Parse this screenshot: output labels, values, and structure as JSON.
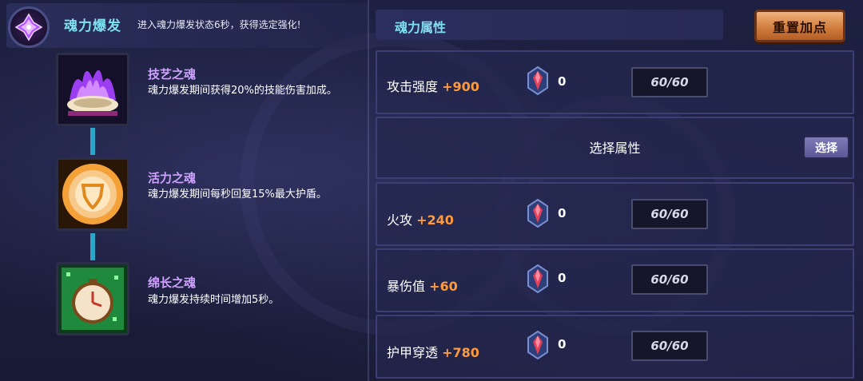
{
  "burst": {
    "title": "魂力爆发",
    "description": "进入魂力爆发状态6秒，获得选定强化!"
  },
  "souls": [
    {
      "name": "技艺之魂",
      "description": "魂力爆发期间获得20%的技能伤害加成。",
      "icon": "purple-flame-shell-icon",
      "color": "#a64dff"
    },
    {
      "name": "活力之魂",
      "description": "魂力爆发期间每秒回复15%最大护盾。",
      "icon": "golden-shield-medallion-icon",
      "color": "#f0a040"
    },
    {
      "name": "绵长之魂",
      "description": "魂力爆发持续时间增加5秒。",
      "icon": "green-stopwatch-icon",
      "color": "#3ddc6a"
    }
  ],
  "attributes": {
    "title": "魂力属性",
    "reset_label": "重置加点",
    "rows": [
      {
        "label": "攻击强度",
        "bonus": "+900",
        "gem_count": "0",
        "level": "60/60"
      },
      {
        "select": true,
        "label": "选择属性",
        "button": "选择"
      },
      {
        "label": "火攻",
        "bonus": "+240",
        "gem_count": "0",
        "level": "60/60"
      },
      {
        "label": "暴伤值",
        "bonus": "+60",
        "gem_count": "0",
        "level": "60/60"
      },
      {
        "label": "护甲穿透",
        "bonus": "+780",
        "gem_count": "0",
        "level": "60/60"
      }
    ]
  },
  "colors": {
    "accent_cyan": "#7fe0f2",
    "soul_name": "#cfa2ff",
    "bonus": "#ff9a3c",
    "reset_button": "#cf7a3c"
  }
}
